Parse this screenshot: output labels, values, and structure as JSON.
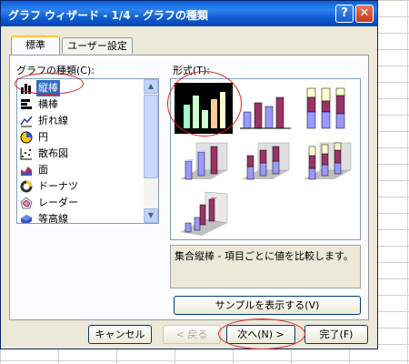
{
  "window": {
    "title": "グラフ ウィザード - 1/4 - グラフの種類",
    "help_glyph": "?",
    "close_glyph": "✕"
  },
  "tabs": [
    {
      "label": "標準",
      "active": true
    },
    {
      "label": "ユーザー設定",
      "active": false
    }
  ],
  "chart_types": {
    "label": "グラフの種類(C):",
    "items": [
      {
        "label": "縦棒",
        "icon": "column-chart-icon",
        "selected": true
      },
      {
        "label": "横棒",
        "icon": "bar-chart-icon",
        "selected": false
      },
      {
        "label": "折れ線",
        "icon": "line-chart-icon",
        "selected": false
      },
      {
        "label": "円",
        "icon": "pie-chart-icon",
        "selected": false
      },
      {
        "label": "散布図",
        "icon": "scatter-chart-icon",
        "selected": false
      },
      {
        "label": "面",
        "icon": "area-chart-icon",
        "selected": false
      },
      {
        "label": "ドーナツ",
        "icon": "doughnut-chart-icon",
        "selected": false
      },
      {
        "label": "レーダー",
        "icon": "radar-chart-icon",
        "selected": false
      },
      {
        "label": "等高線",
        "icon": "surface-chart-icon",
        "selected": false
      }
    ],
    "scroll_up_glyph": "▲",
    "scroll_down_glyph": "▼"
  },
  "subtypes": {
    "label": "形式(T):",
    "selected": "clustered-column",
    "colors": {
      "fill_a": "#9999ff",
      "fill_b": "#993366",
      "fill_c": "#ffffcc",
      "selected_bg": "#000000"
    }
  },
  "description": "集合縦棒 - 項目ごとに値を比較します。",
  "buttons": {
    "sample": "サンプルを表示する(V)",
    "cancel": "キャンセル",
    "back": "< 戻る",
    "next": "次へ(N) >",
    "finish": "完了(F)"
  }
}
